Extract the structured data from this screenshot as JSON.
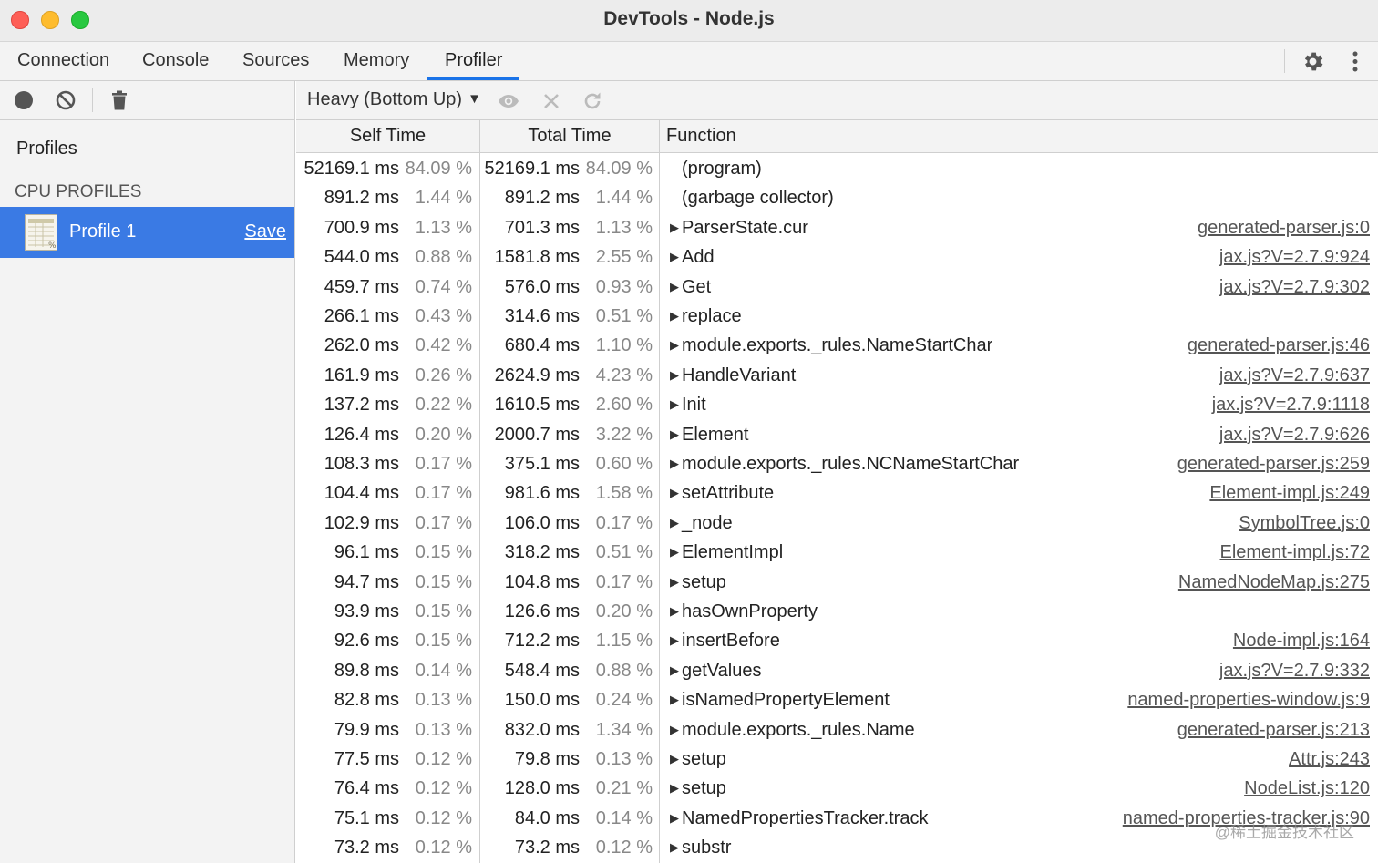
{
  "window": {
    "title": "DevTools - Node.js"
  },
  "tabs": [
    {
      "label": "Connection",
      "active": false
    },
    {
      "label": "Console",
      "active": false
    },
    {
      "label": "Sources",
      "active": false
    },
    {
      "label": "Memory",
      "active": false
    },
    {
      "label": "Profiler",
      "active": true
    }
  ],
  "sidebar": {
    "profiles_label": "Profiles",
    "section_label": "CPU PROFILES",
    "profile": {
      "name": "Profile 1",
      "save_label": "Save"
    }
  },
  "toolbar": {
    "view_mode": "Heavy (Bottom Up)",
    "icons": [
      "record-icon",
      "clear-icon",
      "trash-icon",
      "eye-icon",
      "close-icon",
      "reload-icon"
    ]
  },
  "columns": {
    "self": "Self Time",
    "total": "Total Time",
    "function": "Function"
  },
  "rows": [
    {
      "self_ms": "52169.1 ms",
      "self_pct": "84.09 %",
      "total_ms": "52169.1 ms",
      "total_pct": "84.09 %",
      "fn": "(program)",
      "loc": "",
      "expandable": false
    },
    {
      "self_ms": "891.2 ms",
      "self_pct": "1.44 %",
      "total_ms": "891.2 ms",
      "total_pct": "1.44 %",
      "fn": "(garbage collector)",
      "loc": "",
      "expandable": false
    },
    {
      "self_ms": "700.9 ms",
      "self_pct": "1.13 %",
      "total_ms": "701.3 ms",
      "total_pct": "1.13 %",
      "fn": "ParserState.cur",
      "loc": "generated-parser.js:0",
      "expandable": true
    },
    {
      "self_ms": "544.0 ms",
      "self_pct": "0.88 %",
      "total_ms": "1581.8 ms",
      "total_pct": "2.55 %",
      "fn": "Add",
      "loc": "jax.js?V=2.7.9:924",
      "expandable": true
    },
    {
      "self_ms": "459.7 ms",
      "self_pct": "0.74 %",
      "total_ms": "576.0 ms",
      "total_pct": "0.93 %",
      "fn": "Get",
      "loc": "jax.js?V=2.7.9:302",
      "expandable": true
    },
    {
      "self_ms": "266.1 ms",
      "self_pct": "0.43 %",
      "total_ms": "314.6 ms",
      "total_pct": "0.51 %",
      "fn": "replace",
      "loc": "",
      "expandable": true
    },
    {
      "self_ms": "262.0 ms",
      "self_pct": "0.42 %",
      "total_ms": "680.4 ms",
      "total_pct": "1.10 %",
      "fn": "module.exports._rules.NameStartChar",
      "loc": "generated-parser.js:46",
      "expandable": true
    },
    {
      "self_ms": "161.9 ms",
      "self_pct": "0.26 %",
      "total_ms": "2624.9 ms",
      "total_pct": "4.23 %",
      "fn": "HandleVariant",
      "loc": "jax.js?V=2.7.9:637",
      "expandable": true
    },
    {
      "self_ms": "137.2 ms",
      "self_pct": "0.22 %",
      "total_ms": "1610.5 ms",
      "total_pct": "2.60 %",
      "fn": "Init",
      "loc": "jax.js?V=2.7.9:1118",
      "expandable": true
    },
    {
      "self_ms": "126.4 ms",
      "self_pct": "0.20 %",
      "total_ms": "2000.7 ms",
      "total_pct": "3.22 %",
      "fn": "Element",
      "loc": "jax.js?V=2.7.9:626",
      "expandable": true
    },
    {
      "self_ms": "108.3 ms",
      "self_pct": "0.17 %",
      "total_ms": "375.1 ms",
      "total_pct": "0.60 %",
      "fn": "module.exports._rules.NCNameStartChar",
      "loc": "generated-parser.js:259",
      "expandable": true
    },
    {
      "self_ms": "104.4 ms",
      "self_pct": "0.17 %",
      "total_ms": "981.6 ms",
      "total_pct": "1.58 %",
      "fn": "setAttribute",
      "loc": "Element-impl.js:249",
      "expandable": true
    },
    {
      "self_ms": "102.9 ms",
      "self_pct": "0.17 %",
      "total_ms": "106.0 ms",
      "total_pct": "0.17 %",
      "fn": "_node",
      "loc": "SymbolTree.js:0",
      "expandable": true
    },
    {
      "self_ms": "96.1 ms",
      "self_pct": "0.15 %",
      "total_ms": "318.2 ms",
      "total_pct": "0.51 %",
      "fn": "ElementImpl",
      "loc": "Element-impl.js:72",
      "expandable": true
    },
    {
      "self_ms": "94.7 ms",
      "self_pct": "0.15 %",
      "total_ms": "104.8 ms",
      "total_pct": "0.17 %",
      "fn": "setup",
      "loc": "NamedNodeMap.js:275",
      "expandable": true
    },
    {
      "self_ms": "93.9 ms",
      "self_pct": "0.15 %",
      "total_ms": "126.6 ms",
      "total_pct": "0.20 %",
      "fn": "hasOwnProperty",
      "loc": "",
      "expandable": true
    },
    {
      "self_ms": "92.6 ms",
      "self_pct": "0.15 %",
      "total_ms": "712.2 ms",
      "total_pct": "1.15 %",
      "fn": "insertBefore",
      "loc": "Node-impl.js:164",
      "expandable": true
    },
    {
      "self_ms": "89.8 ms",
      "self_pct": "0.14 %",
      "total_ms": "548.4 ms",
      "total_pct": "0.88 %",
      "fn": "getValues",
      "loc": "jax.js?V=2.7.9:332",
      "expandable": true
    },
    {
      "self_ms": "82.8 ms",
      "self_pct": "0.13 %",
      "total_ms": "150.0 ms",
      "total_pct": "0.24 %",
      "fn": "isNamedPropertyElement",
      "loc": "named-properties-window.js:9",
      "expandable": true
    },
    {
      "self_ms": "79.9 ms",
      "self_pct": "0.13 %",
      "total_ms": "832.0 ms",
      "total_pct": "1.34 %",
      "fn": "module.exports._rules.Name",
      "loc": "generated-parser.js:213",
      "expandable": true
    },
    {
      "self_ms": "77.5 ms",
      "self_pct": "0.12 %",
      "total_ms": "79.8 ms",
      "total_pct": "0.13 %",
      "fn": "setup",
      "loc": "Attr.js:243",
      "expandable": true
    },
    {
      "self_ms": "76.4 ms",
      "self_pct": "0.12 %",
      "total_ms": "128.0 ms",
      "total_pct": "0.21 %",
      "fn": "setup",
      "loc": "NodeList.js:120",
      "expandable": true
    },
    {
      "self_ms": "75.1 ms",
      "self_pct": "0.12 %",
      "total_ms": "84.0 ms",
      "total_pct": "0.14 %",
      "fn": "NamedPropertiesTracker.track",
      "loc": "named-properties-tracker.js:90",
      "expandable": true
    },
    {
      "self_ms": "73.2 ms",
      "self_pct": "0.12 %",
      "total_ms": "73.2 ms",
      "total_pct": "0.12 %",
      "fn": "substr",
      "loc": "",
      "expandable": true
    }
  ],
  "watermark": "@稀土掘金技术社区",
  "colors": {
    "accent": "#1a73e8",
    "selection": "#3a7ae4"
  }
}
